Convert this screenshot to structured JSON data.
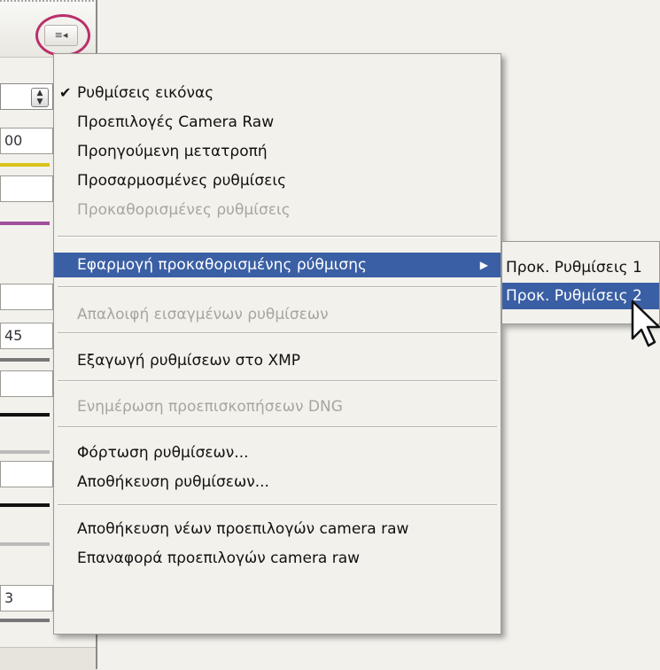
{
  "background": {
    "field_values": [
      "00",
      "45",
      "3"
    ]
  },
  "menu": {
    "items": [
      {
        "label": "Ρυθμίσεις εικόνας",
        "checked": true,
        "enabled": true
      },
      {
        "label": "Προεπιλογές Camera Raw",
        "enabled": true
      },
      {
        "label": "Προηγούμενη μετατροπή",
        "enabled": true
      },
      {
        "label": "Προσαρμοσμένες ρυθμίσεις",
        "enabled": true
      },
      {
        "label": "Προκαθορισμένες ρυθμίσεις",
        "enabled": false
      },
      {
        "label": "Εφαρμογή προκαθορισμένης ρύθμισης",
        "enabled": true,
        "selected": true,
        "has_submenu": true
      },
      {
        "label": "Απαλοιφή εισαγμένων ρυθμίσεων",
        "enabled": false
      },
      {
        "label": "Εξαγωγή ρυθμίσεων στο XMP",
        "enabled": true
      },
      {
        "label": "Ενημέρωση προεπισκοπήσεων DNG",
        "enabled": false
      },
      {
        "label": "Φόρτωση ρυθμίσεων...",
        "enabled": true
      },
      {
        "label": "Αποθήκευση ρυθμίσεων...",
        "enabled": true
      },
      {
        "label": "Αποθήκευση νέων προεπιλογών camera raw",
        "enabled": true
      },
      {
        "label": "Επαναφορά προεπιλογών camera raw",
        "enabled": true
      }
    ]
  },
  "submenu": {
    "items": [
      {
        "label": "Προκ. Ρυθμίσεις 1",
        "selected": false
      },
      {
        "label": "Προκ. Ρυθμίσεις 2",
        "selected": true
      }
    ]
  },
  "icons": {
    "flyout": "flyout-menu-icon",
    "check": "checkmark-icon",
    "submenu_arrow": "submenu-arrow-icon",
    "cursor": "mouse-pointer-icon"
  },
  "colors": {
    "highlight": "#3a5fa4",
    "annotation_ring": "#b9306a",
    "disabled_text": "#a8a59d"
  }
}
